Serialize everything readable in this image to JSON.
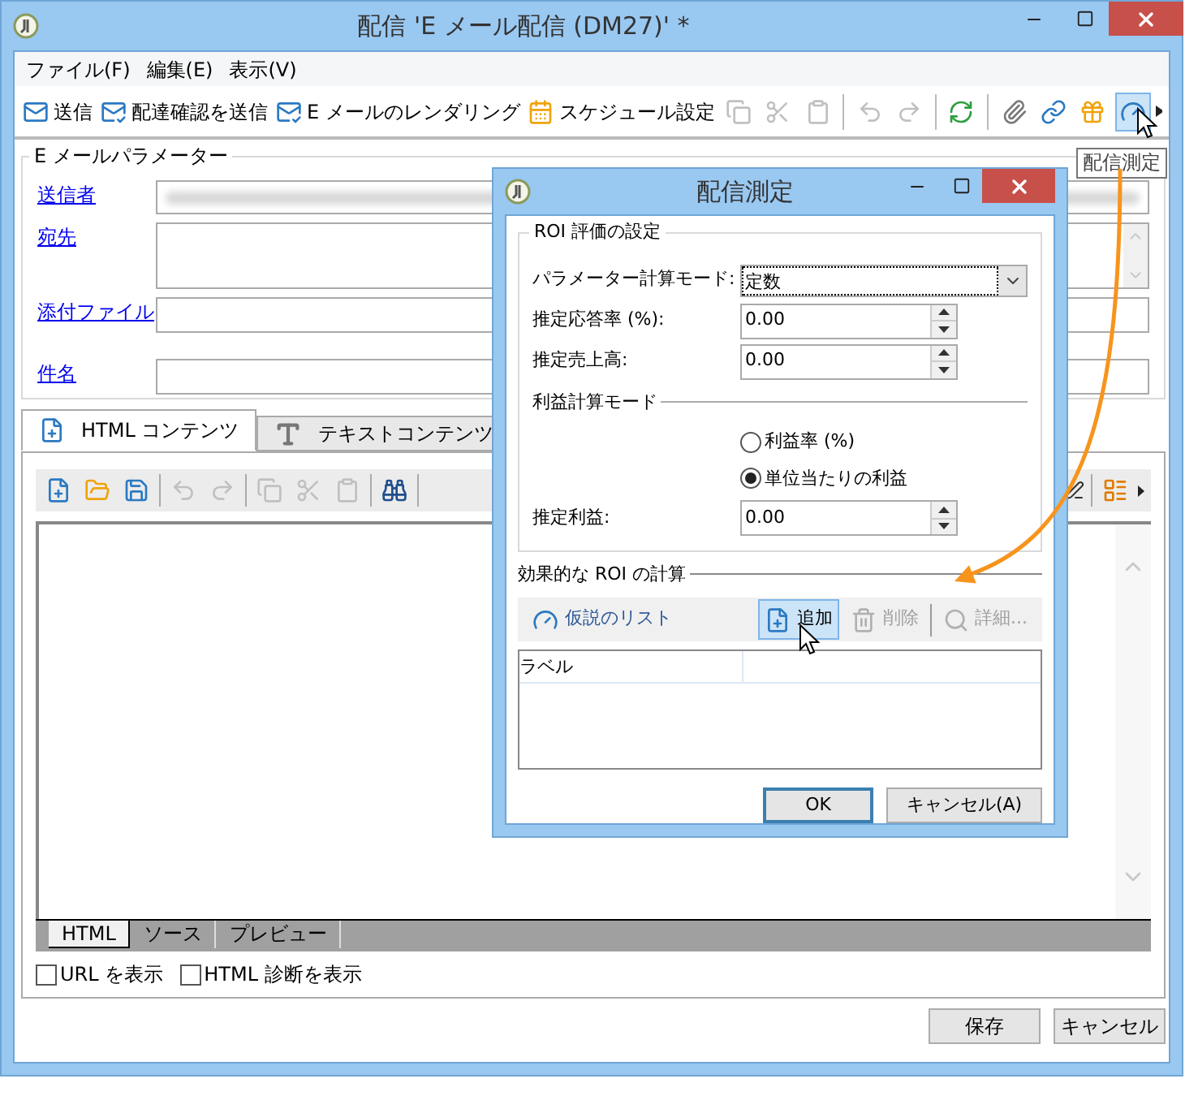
{
  "window": {
    "title": "配信 'E メール配信 (DM27)' *"
  },
  "menu": [
    "ファイル(F)",
    "編集(E)",
    "表示(V)"
  ],
  "toolbar": {
    "labeled": [
      {
        "label": "送信"
      },
      {
        "label": "配達確認を送信"
      },
      {
        "label": "E メールのレンダリング"
      },
      {
        "label": "スケジュール設定"
      }
    ],
    "icons": [
      {
        "disabled": true,
        "hovered": false
      },
      {
        "disabled": true,
        "hovered": false
      },
      {
        "disabled": true,
        "hovered": false
      },
      {
        "disabled": true,
        "hovered": false
      },
      {
        "disabled": true,
        "hovered": false
      },
      {
        "disabled": false,
        "hovered": false
      },
      {
        "disabled": false,
        "hovered": false
      },
      {
        "disabled": false,
        "hovered": false
      },
      {
        "disabled": false,
        "hovered": false
      },
      {
        "disabled": false,
        "hovered": true
      }
    ]
  },
  "tooltip": "配信測定",
  "parameters": {
    "title": "E メールパラメーター",
    "fields": [
      {
        "label": "送信者",
        "kind": "redacted"
      },
      {
        "label": "宛先",
        "kind": "multiline"
      },
      {
        "label": "添付ファイル",
        "kind": "single"
      },
      {
        "label": "件名",
        "kind": "single"
      }
    ]
  },
  "content_tabs": [
    {
      "label": "HTML コンテンツ",
      "selected": true
    },
    {
      "label": "テキストコンテンツ",
      "selected": false
    }
  ],
  "editor_toolbar": [
    {
      "disabled": false
    },
    {
      "disabled": false
    },
    {
      "disabled": false
    },
    {
      "disabled": true
    },
    {
      "disabled": true
    },
    {
      "disabled": true
    },
    {
      "disabled": true
    },
    {
      "disabled": true
    },
    {
      "disabled": false
    },
    {
      "disabled": false
    },
    {
      "disabled": false
    }
  ],
  "editor_tabs": [
    {
      "label": "HTML",
      "selected": true
    },
    {
      "label": "ソース",
      "selected": false
    },
    {
      "label": "プレビュー",
      "selected": false
    }
  ],
  "checkboxes": [
    {
      "label": "URL を表示",
      "checked": false
    },
    {
      "label": "HTML 診断を表示",
      "checked": false
    }
  ],
  "buttons": [
    {
      "label": "保存"
    },
    {
      "label": "キャンセル"
    }
  ],
  "dialog": {
    "title": "配信測定",
    "section": "ROI 評価の設定",
    "fields": [
      {
        "kind": "select",
        "label": "パラメーター計算モード:",
        "value": "定数"
      },
      {
        "kind": "spin",
        "label": "推定応答率 (%):",
        "value": "0.00"
      },
      {
        "kind": "spin",
        "label": "推定売上高:",
        "value": "0.00"
      }
    ],
    "subsection": "利益計算モード",
    "radios": [
      {
        "label": "利益率 (%)",
        "selected": false
      },
      {
        "label": "単位当たりの利益",
        "selected": true
      }
    ],
    "profit": {
      "label": "推定利益:",
      "value": "0.00"
    },
    "section2": "効果的な ROI の計算",
    "toolbar": [
      {
        "label": "仮説のリスト",
        "disabled": false,
        "hovered": false
      },
      {
        "label": "追加",
        "disabled": false,
        "hovered": true
      },
      {
        "label": "削除",
        "disabled": true,
        "hovered": false
      },
      {
        "label": "詳細...",
        "disabled": true,
        "hovered": false
      }
    ],
    "table": {
      "columns": [
        "ラベル"
      ]
    },
    "buttons": [
      {
        "label": "OK",
        "default": true
      },
      {
        "label": "キャンセル(A)",
        "default": false
      }
    ]
  }
}
